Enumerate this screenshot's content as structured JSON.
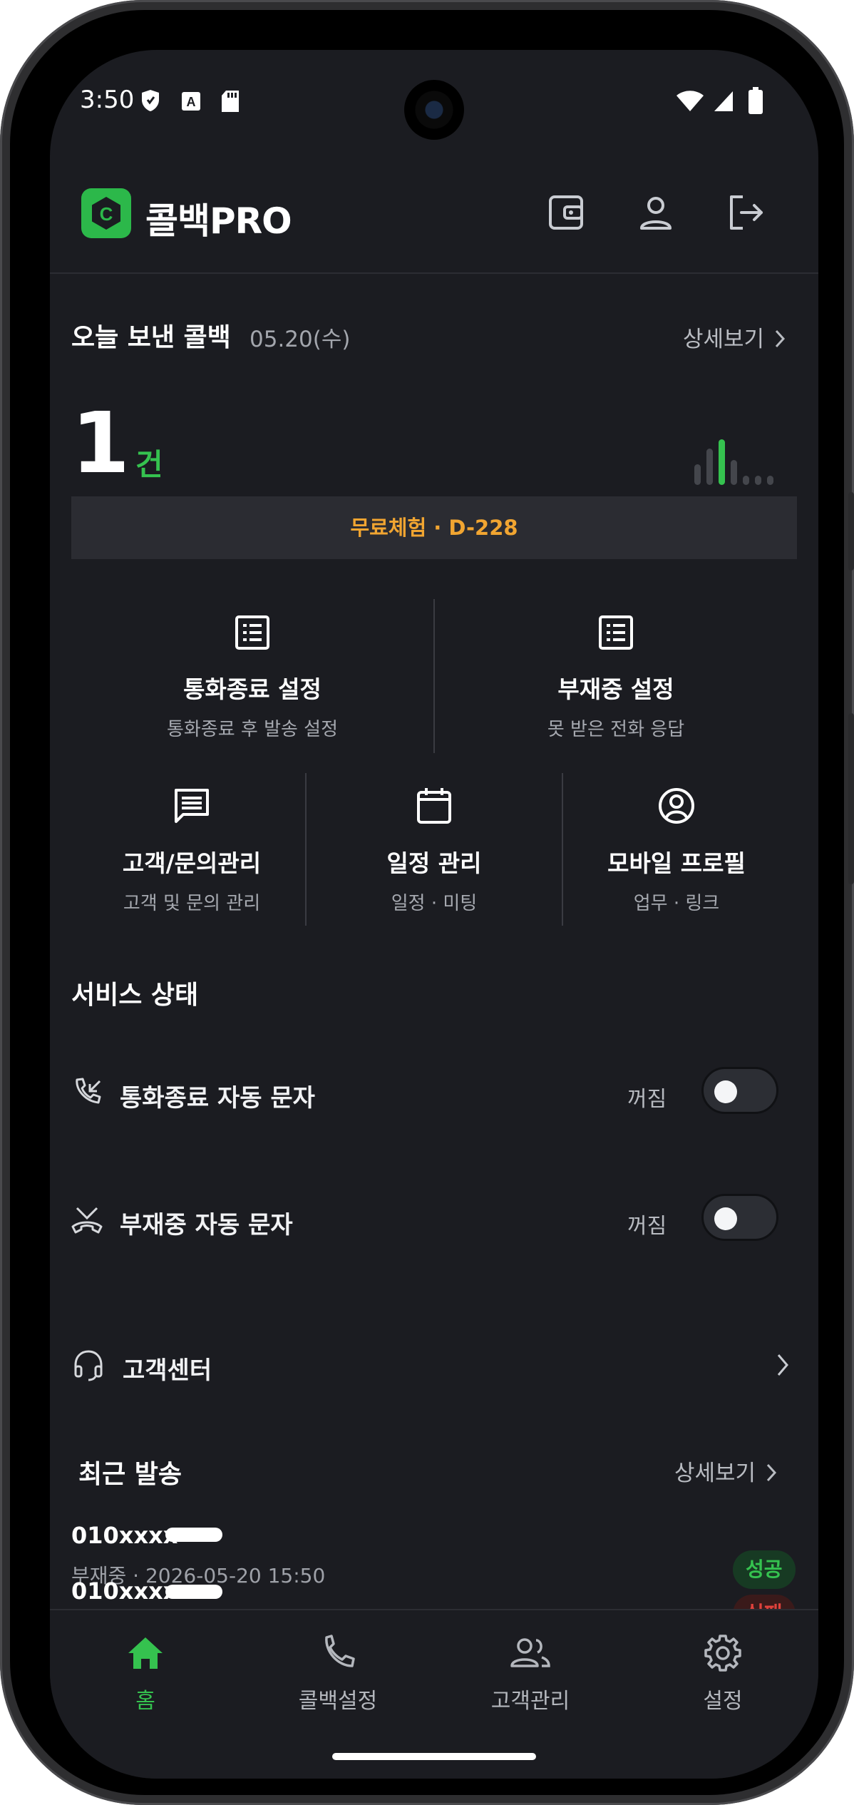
{
  "status_bar": {
    "time": "3:50"
  },
  "header": {
    "brand": "콜백PRO",
    "logo_letter": "C"
  },
  "today": {
    "title": "오늘 보낸 콜백",
    "date": "05.20(수)",
    "detail": "상세보기",
    "count": "1",
    "unit": "건",
    "trend": [
      0.45,
      0.8,
      1.0,
      0.55,
      0.2,
      0.2,
      0.2
    ]
  },
  "trial": "무료체험 · D-228",
  "menu": {
    "call_end": {
      "title": "통화종료 설정",
      "sub": "통화종료 후 발송 설정"
    },
    "absent": {
      "title": "부재중 설정",
      "sub": "못 받은 전화 응답"
    },
    "customer": {
      "title": "고객/문의관리",
      "sub": "고객 및 문의 관리"
    },
    "schedule": {
      "title": "일정 관리",
      "sub": "일정 · 미팅"
    },
    "profile": {
      "title": "모바일 프로필",
      "sub": "업무 · 링크"
    }
  },
  "service": {
    "title": "서비스 상태",
    "rows": [
      {
        "label": "통화종료 자동 문자",
        "state": "꺼짐"
      },
      {
        "label": "부재중 자동 문자",
        "state": "꺼짐"
      }
    ]
  },
  "support": {
    "label": "고객센터"
  },
  "recent": {
    "title": "최근 발송",
    "detail": "상세보기",
    "items": [
      {
        "number": "010xxxx",
        "meta": "부재중 · 2026-05-20 15:50",
        "status": "성공"
      },
      {
        "number": "010xxxx",
        "meta": "",
        "status": "실패"
      }
    ]
  },
  "nav": [
    {
      "label": "홈",
      "active": true
    },
    {
      "label": "콜백설정",
      "active": false
    },
    {
      "label": "고객관리",
      "active": false
    },
    {
      "label": "설정",
      "active": false
    }
  ],
  "colors": {
    "accent": "#35c24f",
    "background": "#1b1c21",
    "trial": "#f1a531",
    "success": "#35c24f",
    "fail": "#e0423c"
  }
}
